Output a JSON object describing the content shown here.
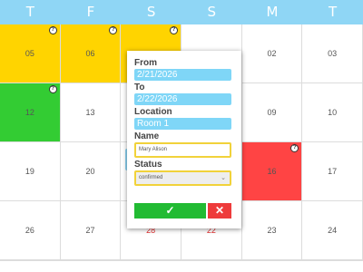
{
  "header": {
    "days": [
      "T",
      "F",
      "S",
      "S",
      "M",
      "T"
    ]
  },
  "grid": {
    "rows": [
      [
        {
          "num": "05",
          "color": "yellow",
          "q": true
        },
        {
          "num": "06",
          "color": "yellow",
          "q": true
        },
        {
          "num": "",
          "color": "yellow",
          "q": true
        },
        {
          "num": "",
          "color": "",
          "q": false
        },
        {
          "num": "02",
          "color": "",
          "q": false
        },
        {
          "num": "03",
          "color": "",
          "q": false
        }
      ],
      [
        {
          "num": "12",
          "color": "green",
          "q": true
        },
        {
          "num": "13",
          "color": "",
          "q": false
        },
        {
          "num": "",
          "color": "",
          "q": false
        },
        {
          "num": "",
          "color": "",
          "q": false
        },
        {
          "num": "09",
          "color": "",
          "q": false
        },
        {
          "num": "10",
          "color": "",
          "q": false
        }
      ],
      [
        {
          "num": "19",
          "color": "",
          "q": false
        },
        {
          "num": "20",
          "color": "",
          "q": false
        },
        {
          "num": "",
          "color": "",
          "q": false
        },
        {
          "num": "",
          "color": "",
          "q": true
        },
        {
          "num": "16",
          "color": "red",
          "q": true
        },
        {
          "num": "17",
          "color": "",
          "q": false
        }
      ],
      [
        {
          "num": "26",
          "color": "",
          "q": false
        },
        {
          "num": "27",
          "color": "",
          "q": false
        },
        {
          "num": "28",
          "color": "",
          "q": false,
          "red": true
        },
        {
          "num": "22",
          "color": "",
          "q": false,
          "red": true
        },
        {
          "num": "23",
          "color": "",
          "q": false
        },
        {
          "num": "24",
          "color": "",
          "q": false
        }
      ]
    ]
  },
  "popup": {
    "from_label": "From",
    "from_value": "2/21/2026",
    "to_label": "To",
    "to_value": "2/22/2026",
    "location_label": "Location",
    "location_value": "Room 1",
    "name_label": "Name",
    "name_value": "Mary Alison",
    "status_label": "Status",
    "status_value": "confirmed",
    "ok_glyph": "✓",
    "cancel_glyph": "✕"
  }
}
